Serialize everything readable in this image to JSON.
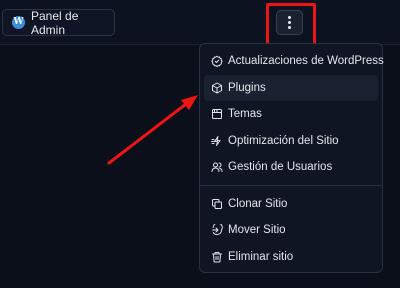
{
  "topbar": {
    "admin_button": {
      "label": "Panel de Admin",
      "icon": "wordpress-icon"
    },
    "more_button": {
      "icon": "vertical-dots-icon"
    }
  },
  "menu": {
    "groups": [
      [
        {
          "label": "Actualizaciones de WordPress",
          "icon": "check-badge-icon"
        },
        {
          "label": "Plugins",
          "icon": "box-icon"
        },
        {
          "label": "Temas",
          "icon": "theme-window-icon"
        },
        {
          "label": "Optimización del Sitio",
          "icon": "lightning-icon"
        },
        {
          "label": "Gestión de Usuarios",
          "icon": "users-icon"
        }
      ],
      [
        {
          "label": "Clonar Sitio",
          "icon": "copy-icon"
        },
        {
          "label": "Mover Sitio",
          "icon": "move-icon"
        },
        {
          "label": "Eliminar sitio",
          "icon": "trash-icon"
        }
      ]
    ],
    "highlighted_item": "Plugins"
  },
  "annotations": {
    "highlight_color": "#ee1414",
    "arrow_color": "#ee1414"
  }
}
